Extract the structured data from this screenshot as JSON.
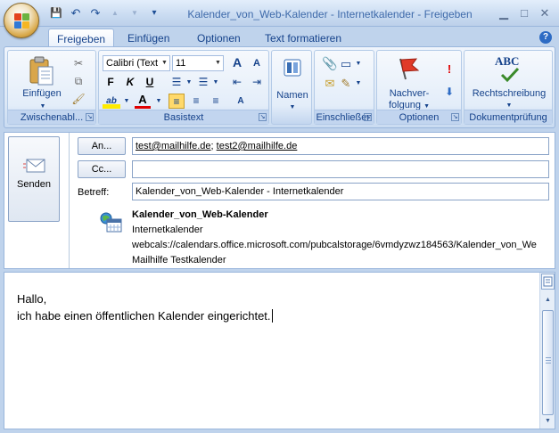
{
  "window": {
    "title": "Kalender_von_Web-Kalender - Internetkalender - Freigeben",
    "controls": {
      "minimize": "▁",
      "maximize": "□",
      "close": "✕"
    }
  },
  "qat": {
    "save": "💾",
    "undo": "↶",
    "redo": "↷",
    "up": "▲",
    "down": "▼",
    "customize": "▾"
  },
  "tabs": [
    {
      "label": "Freigeben",
      "active": true
    },
    {
      "label": "Einfügen",
      "active": false
    },
    {
      "label": "Optionen",
      "active": false
    },
    {
      "label": "Text formatieren",
      "active": false
    }
  ],
  "help": "?",
  "ribbon": {
    "clipboard": {
      "label": "Zwischenabl...",
      "paste": "Einfügen",
      "cut": "✂",
      "copy": "⧉",
      "format_painter": "🖌"
    },
    "basic_text": {
      "label": "Basistext",
      "font": "Calibri (Text",
      "size": "11",
      "grow": "A",
      "shrink": "A",
      "bold": "F",
      "italic": "K",
      "underline": "U",
      "bullets": "☰",
      "numbering": "☰",
      "highlight": "ab",
      "font_color": "A",
      "align_left": "≡",
      "align_center": "≡",
      "align_right": "≡",
      "clear": "A"
    },
    "names": {
      "label": "Namen"
    },
    "include": {
      "label": "Einschließen"
    },
    "options": {
      "label": "Optionen",
      "follow_up_line1": "Nachver-",
      "follow_up_line2": "folgung",
      "high": "!",
      "low": "⬇"
    },
    "proofing": {
      "label": "Dokumentprüfung",
      "spelling": "Rechtschreibung",
      "abc": "ABC"
    }
  },
  "compose": {
    "send": "Senden",
    "to_button": "An...",
    "cc_button": "Cc...",
    "subject_label": "Betreff:",
    "to": [
      "test@mailhilfe.de",
      "test2@mailhilfe.de"
    ],
    "cc": "",
    "subject": "Kalender_von_Web-Kalender - Internetkalender",
    "attachment": {
      "name": "Kalender_von_Web-Kalender",
      "type": "Internetkalender",
      "url": "webcals://calendars.office.microsoft.com/pubcalstorage/6vmdyzwz184563/Kalender_von_We",
      "description": "Mailhilfe Testkalender"
    }
  },
  "message_body": {
    "line1": "Hallo,",
    "line2": "ich habe einen öffentlichen Kalender eingerichtet."
  },
  "colors": {
    "accent": "#15428b",
    "ribbon_bg": "#dce8f6"
  }
}
